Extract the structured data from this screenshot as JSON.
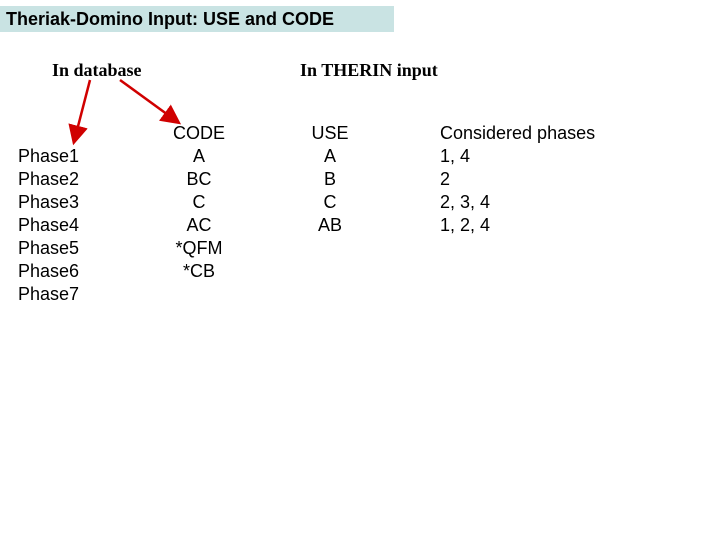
{
  "title": "Theriak-Domino Input: USE and CODE",
  "headers": {
    "database": "In database",
    "therin": "In THERIN input"
  },
  "columns": {
    "phase": {
      "rows": [
        "Phase1",
        "Phase2",
        "Phase3",
        "Phase4",
        "Phase5",
        "Phase6",
        "Phase7"
      ]
    },
    "code": {
      "label": "CODE",
      "rows": [
        "A",
        "BC",
        "C",
        "AC",
        "",
        "*QFM",
        "*CB"
      ]
    },
    "use": {
      "label": "USE",
      "rows": [
        "A",
        "B",
        "C",
        "AB"
      ]
    },
    "considered": {
      "label": "Considered phases",
      "rows": [
        "1, 4",
        "2",
        "2, 3, 4",
        "1, 2, 4"
      ]
    }
  }
}
